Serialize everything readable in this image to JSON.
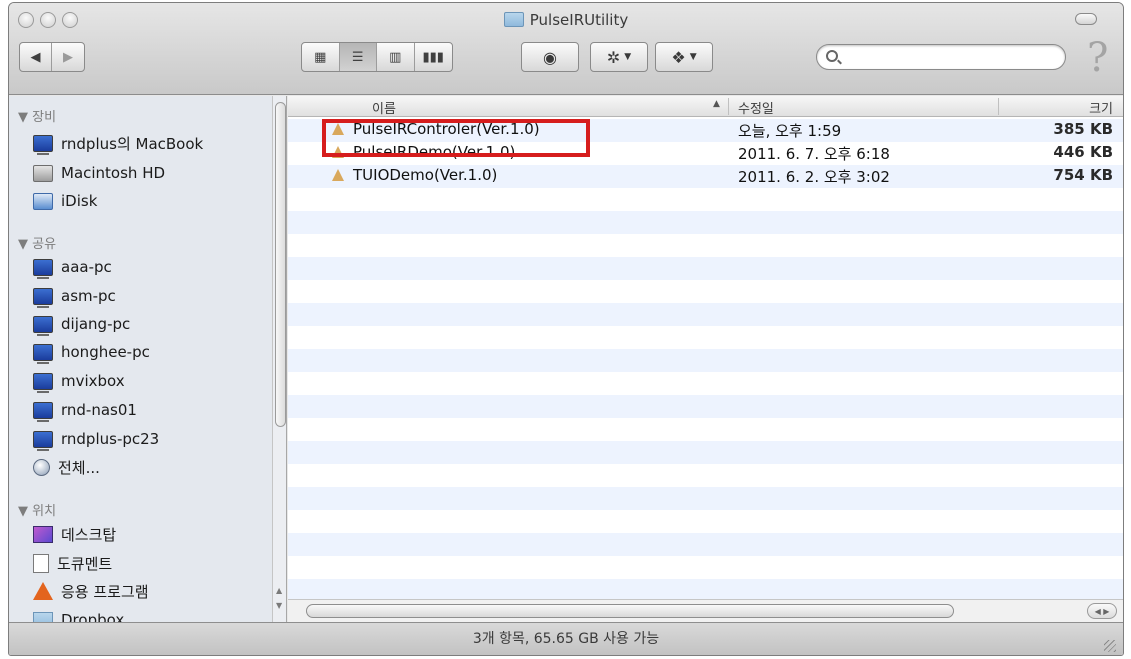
{
  "window": {
    "title": "PulseIRUtility",
    "colors": {
      "highlight_box": "#d61d1d",
      "row_stripe": "#edf3fe",
      "accent_blue": "#3b6fd1"
    }
  },
  "toolbar": {
    "back_icon": "back-arrow-icon",
    "forward_icon": "forward-arrow-icon",
    "view_icons": [
      "icon-view-icon",
      "list-view-icon",
      "column-view-icon",
      "coverflow-view-icon"
    ],
    "quicklook_icon": "eye-icon",
    "action_icon": "gear-icon",
    "share_icon": "dropbox-icon",
    "search": {
      "placeholder": "",
      "value": ""
    }
  },
  "sidebar": {
    "sections": [
      {
        "label": "장비",
        "items": [
          {
            "label": "rndplus의 MacBook",
            "icon": "computer-icon"
          },
          {
            "label": "Macintosh HD",
            "icon": "hard-drive-icon"
          },
          {
            "label": "iDisk",
            "icon": "idisk-icon"
          }
        ]
      },
      {
        "label": "공유",
        "items": [
          {
            "label": "aaa-pc",
            "icon": "network-computer-icon"
          },
          {
            "label": "asm-pc",
            "icon": "network-computer-icon"
          },
          {
            "label": "dijang-pc",
            "icon": "network-computer-icon"
          },
          {
            "label": "honghee-pc",
            "icon": "network-computer-icon"
          },
          {
            "label": "mvixbox",
            "icon": "network-computer-icon"
          },
          {
            "label": "rnd-nas01",
            "icon": "network-computer-icon"
          },
          {
            "label": "rndplus-pc23",
            "icon": "network-computer-icon"
          },
          {
            "label": "전체...",
            "icon": "globe-icon"
          }
        ]
      },
      {
        "label": "위치",
        "items": [
          {
            "label": "데스크탑",
            "icon": "desktop-icon"
          },
          {
            "label": "도큐멘트",
            "icon": "documents-icon"
          },
          {
            "label": "응용 프로그램",
            "icon": "applications-icon"
          },
          {
            "label": "Dropbox",
            "icon": "folder-icon"
          }
        ]
      }
    ]
  },
  "file_list": {
    "columns": {
      "name": "이름",
      "modified": "수정일",
      "size": "크기"
    },
    "rows": [
      {
        "name": "PulseIRControler(Ver.1.0)",
        "modified": "오늘, 오후 1:59",
        "size": "385 KB",
        "highlighted": true
      },
      {
        "name": "PulseIRDemo(Ver.1.0)",
        "modified": "2011. 6. 7. 오후 6:18",
        "size": "446 KB",
        "highlighted": false
      },
      {
        "name": "TUIODemo(Ver.1.0)",
        "modified": "2011. 6. 2. 오후 3:02",
        "size": "754 KB",
        "highlighted": false
      }
    ]
  },
  "status_bar": {
    "text": "3개 항목, 65.65 GB 사용 가능"
  }
}
